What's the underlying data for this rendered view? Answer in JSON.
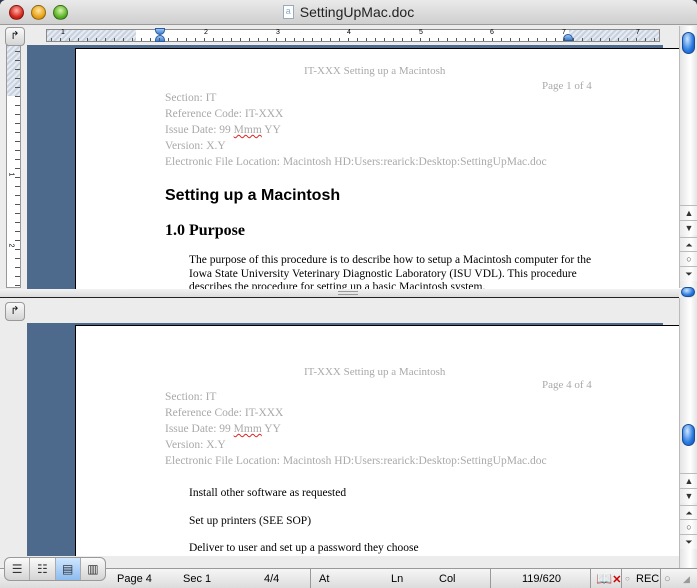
{
  "window": {
    "title": "SettingUpMac.doc",
    "doc_icon": "word-doc-icon"
  },
  "ruler": {
    "h_numbers": [
      "1",
      "1",
      "2",
      "3",
      "4",
      "5",
      "6",
      "7"
    ],
    "v_numbers": [
      "1",
      "2"
    ]
  },
  "top_pane": {
    "header_title": "IT-XXX Setting up a Macintosh",
    "page_label": "Page 1 of 4",
    "meta": {
      "section": "Section: IT",
      "reference": "Reference  Code: IT-XXX",
      "issue_prefix": "Issue Date: 99 ",
      "issue_misspelled": "Mmm",
      "issue_suffix": " YY",
      "version": "Version: X.Y",
      "file_location": "Electronic  File  Location:  Macintosh  HD:Users:rearick:Desktop:SettingUpMac.doc"
    },
    "heading1": "Setting up a Macintosh",
    "heading2": "1.0 Purpose",
    "paragraph": "The purpose of this procedure is to describe how to setup a Macintosh computer for the Iowa State University Veterinary  Diagnostic Laboratory (ISU VDL).  This procedure describes  the procedure  for setting up a basic Macintosh  system."
  },
  "bottom_pane": {
    "header_title": "IT-XXX Setting up a Macintosh",
    "page_label": "Page 4 of 4",
    "meta": {
      "section": "Section: IT",
      "reference": "Reference  Code: IT-XXX",
      "issue_prefix": "Issue Date: 99 ",
      "issue_misspelled": "Mmm",
      "issue_suffix": " YY",
      "version": "Version: X.Y",
      "file_location": "Electronic  File  Location:  Macintosh  HD:Users:rearick:Desktop:SettingUpMac.doc"
    },
    "lines": [
      "Install other software as requested",
      "Set up printers  (SEE SOP)",
      "Deliver to user and set up a password they choose"
    ]
  },
  "view_buttons": [
    {
      "name": "normal-view",
      "glyph": "☰",
      "active": false
    },
    {
      "name": "outline-view",
      "glyph": "☷",
      "active": false
    },
    {
      "name": "page-layout-view",
      "glyph": "▤",
      "active": true
    },
    {
      "name": "notebook-view",
      "glyph": "▥",
      "active": false
    }
  ],
  "tab_selector_glyph": "↱",
  "scroll_buttons": {
    "up": "▲",
    "down": "▼",
    "prev_page": "⏶",
    "select_browse": "○",
    "next_page": "⏷"
  },
  "status": {
    "page": "Page  4",
    "sec": "Sec  1",
    "page_of": "4/4",
    "at": "At",
    "ln": "Ln",
    "col": "Col",
    "word_count": "119/620",
    "spelling_icon": "book-x-icon",
    "rec": "REC",
    "trk_partial": "○"
  }
}
